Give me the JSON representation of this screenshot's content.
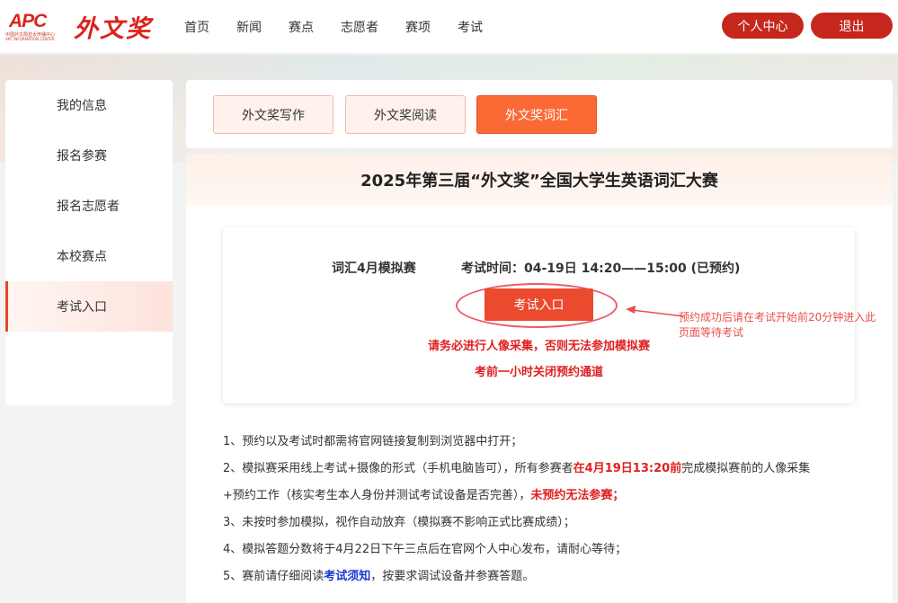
{
  "logo": {
    "apc": "APC",
    "sub": "中国外文局亚太传播中心",
    "sub2": "APC INFORMATION CENTER",
    "brand": "外文奖"
  },
  "nav": [
    "首页",
    "新闻",
    "赛点",
    "志愿者",
    "赛项",
    "考试"
  ],
  "header_buttons": {
    "center": "个人中心",
    "logout": "退出"
  },
  "sidebar": [
    "我的信息",
    "报名参赛",
    "报名志愿者",
    "本校赛点",
    "考试入口"
  ],
  "sidebar_active_index": 4,
  "tabs": [
    "外文奖写作",
    "外文奖阅读",
    "外文奖词汇"
  ],
  "tabs_active_index": 2,
  "main_title": "2025年第三届“外文奖”全国大学生英语词汇大赛",
  "exam": {
    "name": "词汇4月模拟赛",
    "time": "考试时间：04-19日 14:20——15:00 (已预约)",
    "enter_button": "考试入口",
    "warning1": "请务必进行人像采集，否则无法参加模拟赛",
    "warning2": "考前一小时关闭预约通道"
  },
  "annotation": "预约成功后请在考试开始前20分钟进入此页面等待考试",
  "notes": {
    "n1": "1、预约以及考试时都需将官网链接复制到浏览器中打开；",
    "n2_a": "2、模拟赛采用线上考试+摄像的形式（手机电脑皆可），所有参赛者",
    "n2_red": "在4月19日13:20前",
    "n2_b": "完成模拟赛前的人像采集",
    "n2_c": "+预约工作（核实考生本人身份并测试考试设备是否完善），",
    "n2_red2": "未预约无法参赛；",
    "n3": "3、未按时参加模拟，视作自动放弃（模拟赛不影响正式比赛成绩）；",
    "n4": "4、模拟答题分数将于4月22日下午三点后在官网个人中心发布，请耐心等待；",
    "n5_a": "5、赛前请仔细阅读",
    "n5_link": "考试须知",
    "n5_b": "，按要求调试设备并参赛答题。"
  },
  "colors": {
    "brand_red": "#c6271d",
    "active_tab": "#fb6a35",
    "warning_red": "#e02020",
    "link_blue": "#1a3ad6"
  }
}
